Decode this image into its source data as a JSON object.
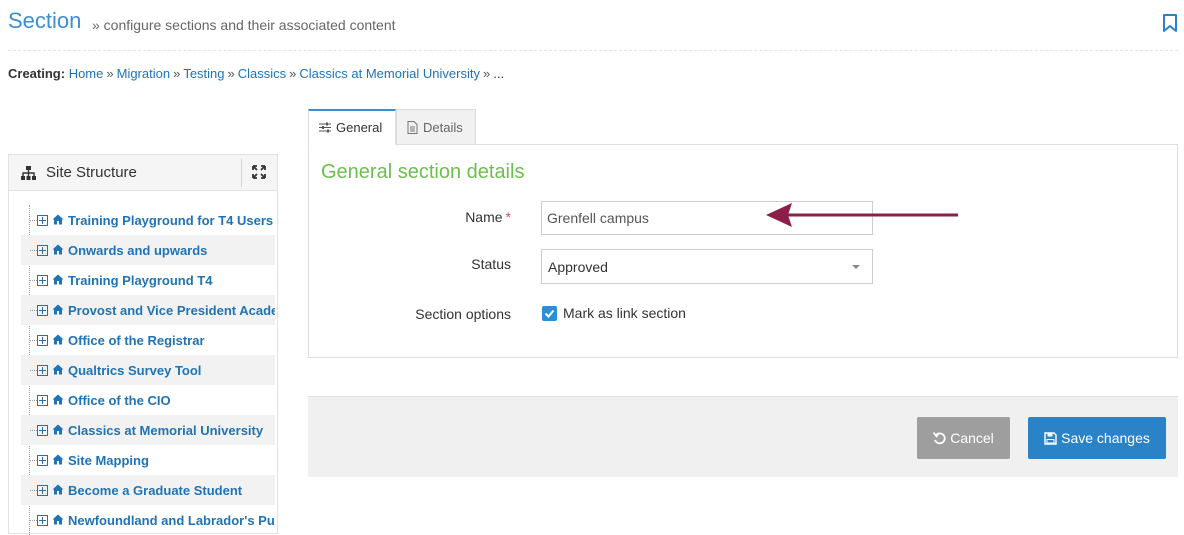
{
  "header": {
    "title": "Section",
    "subtitle": "» configure sections and their associated content"
  },
  "breadcrumb": {
    "label": "Creating:",
    "items": [
      "Home",
      "Migration",
      "Testing",
      "Classics",
      "Classics at Memorial University"
    ],
    "separator": "»",
    "trailing": "..."
  },
  "sidebar": {
    "title": "Site Structure",
    "items": [
      {
        "label": "Training Playground for T4 Users"
      },
      {
        "label": "Onwards and upwards"
      },
      {
        "label": "Training Playground T4"
      },
      {
        "label": "Provost and Vice President Academic"
      },
      {
        "label": "Office of the Registrar"
      },
      {
        "label": "Qualtrics Survey Tool"
      },
      {
        "label": "Office of the CIO"
      },
      {
        "label": "Classics at Memorial University"
      },
      {
        "label": "Site Mapping"
      },
      {
        "label": "Become a Graduate Student"
      },
      {
        "label": "Newfoundland and Labrador's Public University"
      }
    ]
  },
  "tabs": [
    {
      "label": "General",
      "active": true
    },
    {
      "label": "Details",
      "active": false
    }
  ],
  "form": {
    "title": "General section details",
    "name_label": "Name",
    "required_mark": "*",
    "name_value": "Grenfell campus",
    "status_label": "Status",
    "status_value": "Approved",
    "options_label": "Section options",
    "link_section_checked": true,
    "link_section_label": "Mark as link section"
  },
  "footer": {
    "cancel_label": "Cancel",
    "save_label": "Save changes"
  },
  "colors": {
    "accent": "#3e8fcf",
    "panel_title": "#6cbf4f",
    "arrow": "#8b1f4a",
    "cancel": "#9e9e9e",
    "save": "#2a82c7"
  }
}
